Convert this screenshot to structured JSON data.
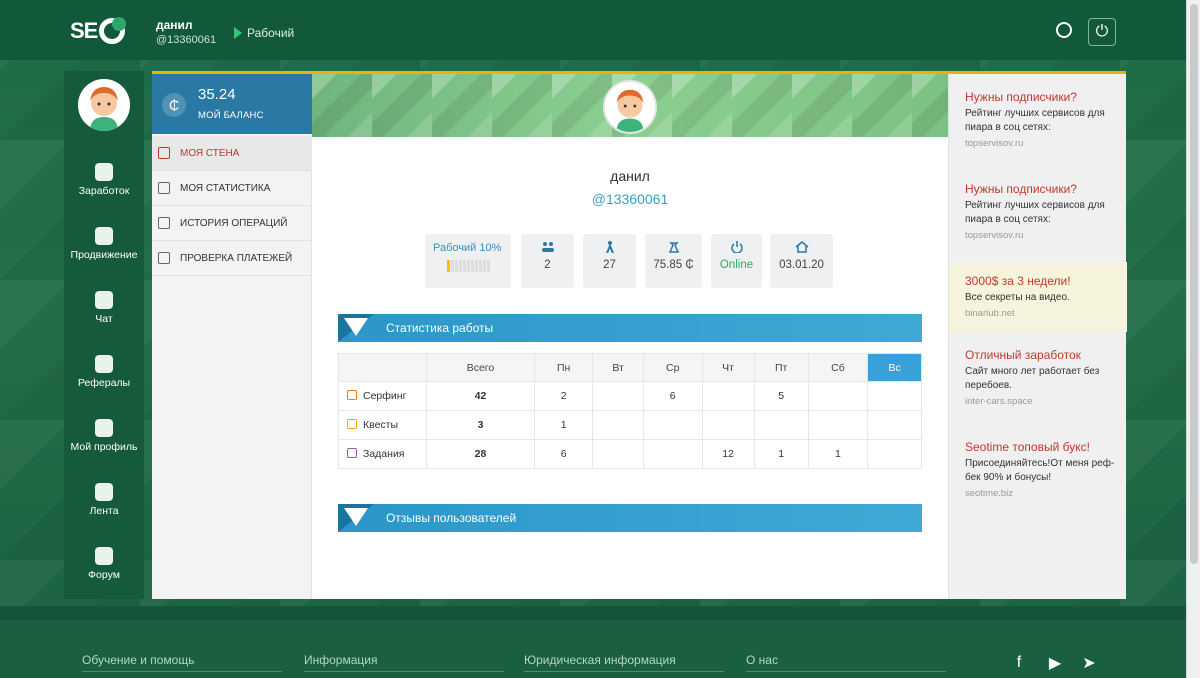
{
  "header": {
    "logo_text": "SE",
    "username": "данил",
    "handle": "@13360061",
    "status": "Рабочий"
  },
  "sidebar": {
    "items": [
      {
        "label": "Заработок",
        "icon": "money-bag-icon"
      },
      {
        "label": "Продвижение",
        "icon": "rocket-icon"
      },
      {
        "label": "Чат",
        "icon": "chat-icon"
      },
      {
        "label": "Рефералы",
        "icon": "users-icon"
      },
      {
        "label": "Мой профиль",
        "icon": "gear-icon"
      },
      {
        "label": "Лента",
        "icon": "coffee-icon"
      },
      {
        "label": "Форум",
        "icon": "forum-icon"
      }
    ]
  },
  "balance": {
    "amount": "35.24",
    "label": "МОЙ БАЛАНС",
    "currency_symbol": "₵"
  },
  "menu": {
    "items": [
      {
        "label": "МОЯ СТЕНА",
        "active": true
      },
      {
        "label": "МОЯ СТАТИСТИКА",
        "active": false
      },
      {
        "label": "ИСТОРИЯ ОПЕРАЦИЙ",
        "active": false
      },
      {
        "label": "ПРОВЕРКА ПЛАТЕЖЕЙ",
        "active": false
      }
    ]
  },
  "profile": {
    "name": "данил",
    "handle": "@13360061",
    "level_label": "Рабочий 10%",
    "level_progress": 0.1,
    "stats": [
      {
        "value": "2",
        "icon": "referrals-icon"
      },
      {
        "value": "27",
        "icon": "visits-icon"
      },
      {
        "value": "75.85 ₵",
        "icon": "money-bag-icon"
      },
      {
        "value": "Online",
        "icon": "power-icon"
      },
      {
        "value": "03.01.20",
        "icon": "home-icon"
      }
    ]
  },
  "work_stats": {
    "title": "Статистика работы",
    "columns": [
      "",
      "Всего",
      "Пн",
      "Вт",
      "Ср",
      "Чт",
      "Пт",
      "Сб",
      "Вс"
    ],
    "rows": [
      {
        "label": "Серфинг",
        "cells": [
          "42",
          "2",
          "",
          "6",
          "",
          "5",
          "",
          ""
        ]
      },
      {
        "label": "Квесты",
        "cells": [
          "3",
          "1",
          "",
          "",
          "",
          "",
          "",
          ""
        ]
      },
      {
        "label": "Задания",
        "cells": [
          "28",
          "6",
          "",
          "",
          "12",
          "1",
          "1",
          ""
        ]
      }
    ]
  },
  "reviews": {
    "title": "Отзывы пользователей"
  },
  "ads": [
    {
      "title": "Нужны подписчики?",
      "text": "Рейтинг лучших сервисов для пиара в соц сетях:",
      "url": "topservisov.ru"
    },
    {
      "title": "Нужны подписчики?",
      "text": "Рейтинг лучших сервисов для пиара в соц сетях:",
      "url": "topservisov.ru"
    },
    {
      "title": "3000$ за 3 недели!",
      "text": "Все секреты на видео.",
      "url": "binariub.net"
    },
    {
      "title": "Отличный заработок",
      "text": "Сайт много лет работает без перебоев.",
      "url": "inter-cars.space"
    },
    {
      "title": "Seotime топовый букс!",
      "text": "Присоединяйтесь!От меня реф-бек 90% и бонусы!",
      "url": "seotime.biz"
    }
  ],
  "footer": {
    "links": [
      "Обучение и помощь",
      "Информация",
      "Юридическая информация",
      "О нас"
    ],
    "social": [
      {
        "name": "facebook-icon",
        "glyph": "f"
      },
      {
        "name": "youtube-icon",
        "glyph": "▶"
      },
      {
        "name": "telegram-icon",
        "glyph": "➤"
      }
    ]
  },
  "colors": {
    "accent": "#2a79a5",
    "brand": "#1d6c45",
    "active": "#c0392b",
    "today": "#3aa0d8"
  }
}
